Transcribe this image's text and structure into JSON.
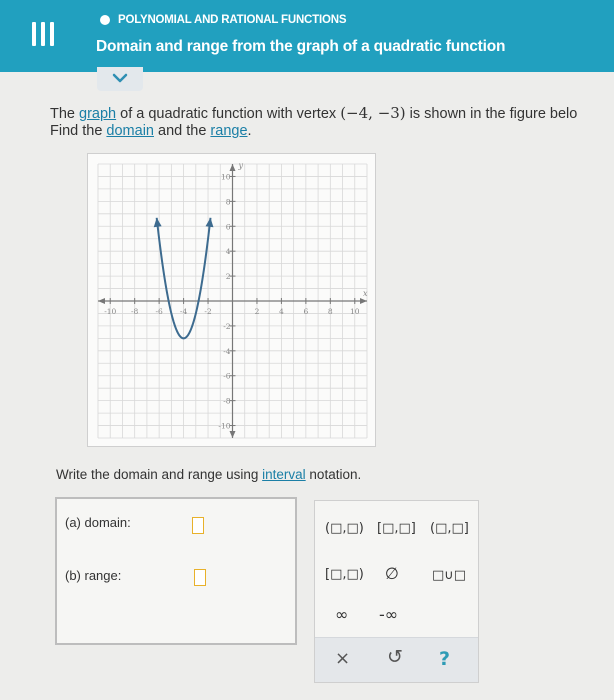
{
  "header": {
    "topic": "POLYNOMIAL AND RATIONAL FUNCTIONS",
    "title": "Domain and range from the graph of a quadratic function",
    "menu_icon": "hamburger-menu-icon"
  },
  "expand_icon": "chevron-down-icon",
  "question": {
    "line1_a": "The ",
    "graph_link": "graph",
    "line1_b": " of a quadratic function with vertex ",
    "vertex": "(−4, −3)",
    "line1_c": " is shown in the figure belo",
    "line2_a": "Find the ",
    "domain_link": "domain",
    "line2_b": " and the ",
    "range_link": "range",
    "line2_c": "."
  },
  "chart_data": {
    "type": "line",
    "series": [
      {
        "equation": "y = 2(x + 4)^2 - 3",
        "vertex": [
          -4,
          -3
        ],
        "x_domain_shown": [
          -6.2,
          -1.8
        ],
        "arrows_at_ends": true
      }
    ],
    "xlim": [
      -11,
      11
    ],
    "ylim": [
      -11,
      11
    ],
    "x_ticks": [
      -10,
      -8,
      -6,
      -4,
      -2,
      2,
      4,
      6,
      8,
      10
    ],
    "y_ticks": [
      10,
      8,
      6,
      4,
      2,
      -2,
      -4,
      -6,
      -8,
      -10
    ],
    "xlabel": "x",
    "ylabel": "y",
    "grid": true,
    "colors": {
      "curve": "#3d6b8f",
      "grid": "#d8d8d8",
      "axis": "#777777",
      "tick_label": "#888888"
    }
  },
  "instruction": {
    "text_a": "Write the domain and range using ",
    "interval_link": "interval",
    "text_b": " notation."
  },
  "answers": {
    "domain_label": "(a)  domain:",
    "range_label": "(b)  range:",
    "domain_value": "",
    "range_value": ""
  },
  "keypad": {
    "open_open": "(□,□)",
    "closed_closed": "[□,□]",
    "open_closed": "(□,□]",
    "closed_open": "[□,□)",
    "empty_set": "∅",
    "union": "□∪□",
    "infinity": "∞",
    "neg_infinity": "-∞",
    "clear": "×",
    "undo": "↺",
    "help": "?"
  },
  "colors": {
    "header_bg": "#21a0bf",
    "link": "#1b7fa6",
    "input_border": "#e8b12a",
    "help": "#2e9bb5"
  }
}
